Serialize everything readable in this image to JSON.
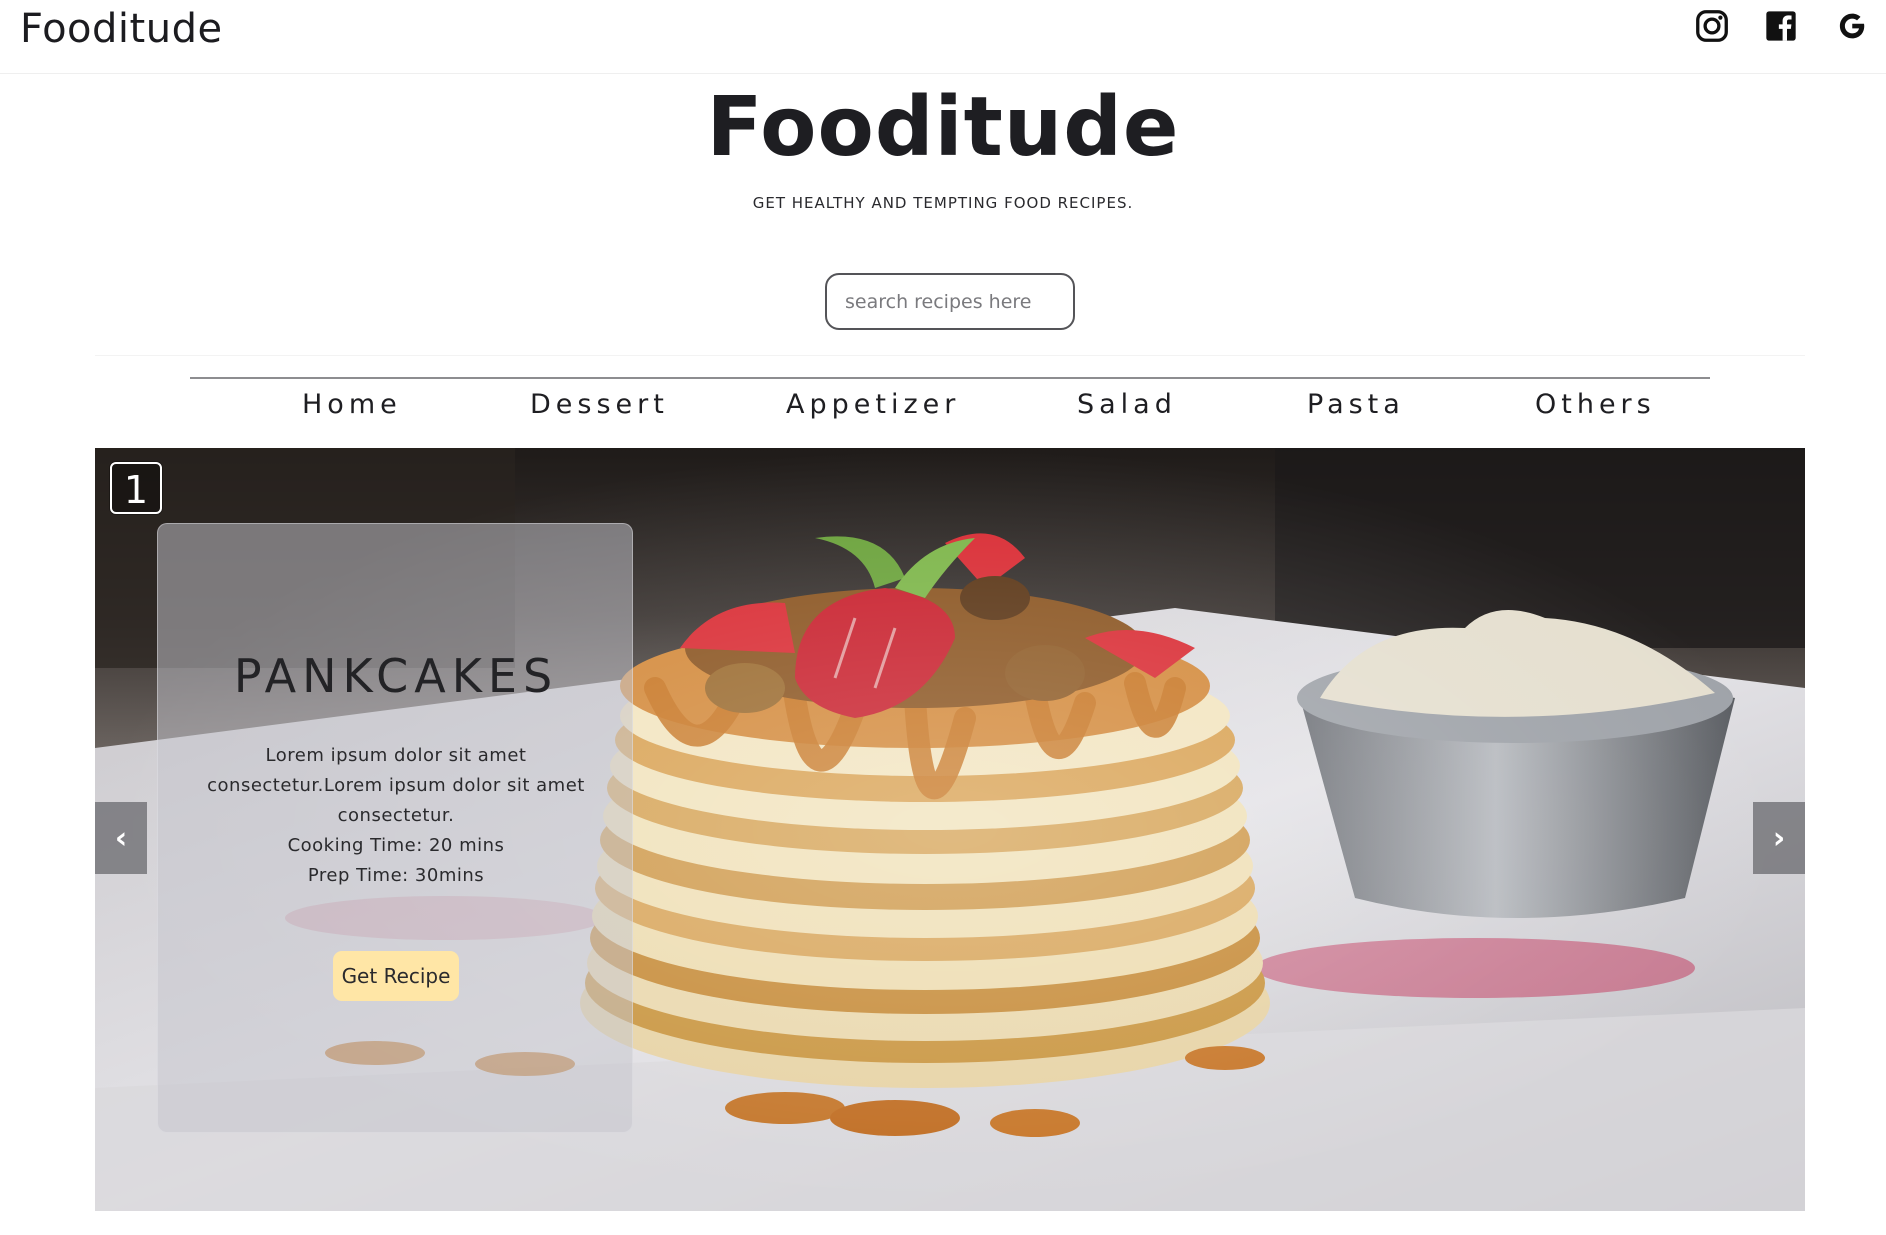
{
  "brand": {
    "small_title": "Fooditude"
  },
  "social": [
    {
      "name": "instagram-icon"
    },
    {
      "name": "facebook-icon"
    },
    {
      "name": "google-icon"
    }
  ],
  "hero": {
    "title": "Fooditude",
    "tagline": "GET HEALTHY AND TEMPTING FOOD RECIPES."
  },
  "search": {
    "placeholder": "search recipes here",
    "value": ""
  },
  "nav": {
    "items": [
      {
        "label": "Home"
      },
      {
        "label": "Dessert"
      },
      {
        "label": "Appetizer"
      },
      {
        "label": "Salad"
      },
      {
        "label": "Pasta"
      },
      {
        "label": "Others"
      }
    ]
  },
  "slider": {
    "slide_number": "1",
    "prev_icon": "‹",
    "next_icon": "›",
    "card": {
      "title": "PANKCAKES",
      "desc_lines": [
        "Lorem ipsum dolor sit amet",
        "consectetur.Lorem ipsum dolor sit amet",
        "consectetur."
      ],
      "cooking_time": "Cooking Time: 20 mins",
      "prep_time": "Prep Time: 30mins",
      "button_label": "Get Recipe"
    }
  },
  "colors": {
    "text_dark": "#1e1e22",
    "button_bg": "#ffe6a6",
    "card_bg": "rgba(198,198,206,0.52)"
  }
}
